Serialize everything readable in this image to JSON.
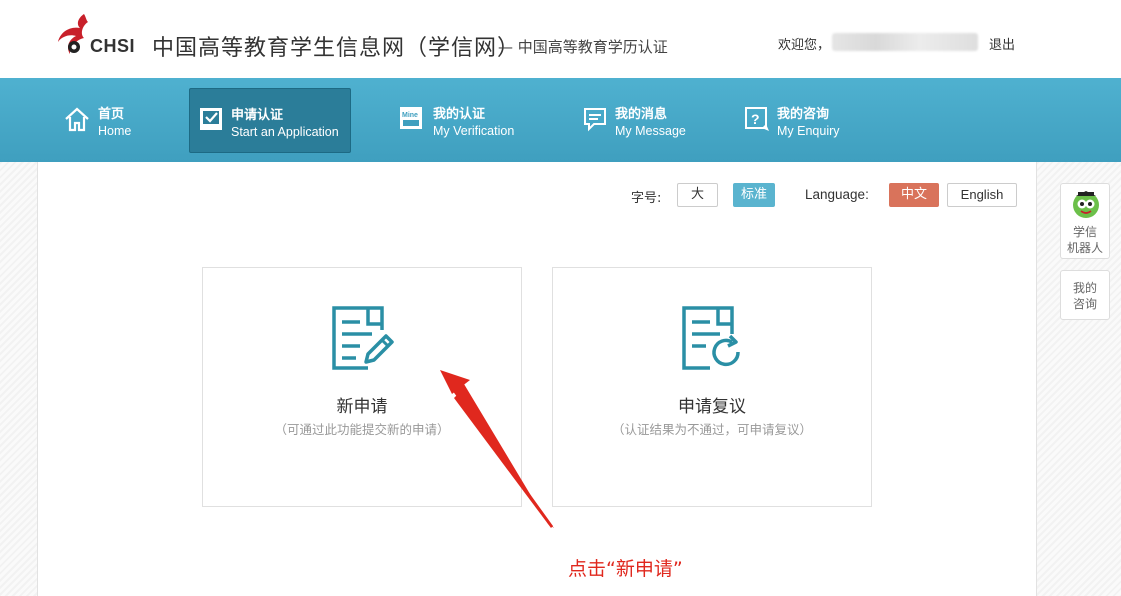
{
  "header": {
    "logo_text": "CHSI",
    "site_title": "中国高等教育学生信息网（学信网）",
    "site_subtitle": "— 中国高等教育学历认证",
    "welcome": "欢迎您，",
    "logout": "退出"
  },
  "nav": {
    "items": [
      {
        "zh": "首页",
        "en": "Home",
        "icon": "home-icon"
      },
      {
        "zh": "申请认证",
        "en": "Start an Application",
        "icon": "checkbox-icon",
        "active": true
      },
      {
        "zh": "我的认证",
        "en": "My Verification",
        "icon": "mine-icon"
      },
      {
        "zh": "我的消息",
        "en": "My Message",
        "icon": "message-icon"
      },
      {
        "zh": "我的咨询",
        "en": "My Enquiry",
        "icon": "question-icon"
      }
    ]
  },
  "toolbar": {
    "font_label": "字号:",
    "font_large": "大",
    "font_standard": "标准",
    "language_label": "Language:",
    "lang_zh": "中文",
    "lang_en": "English"
  },
  "cards": [
    {
      "title": "新申请",
      "desc": "（可通过此功能提交新的申请）",
      "icon": "edit-document-icon"
    },
    {
      "title": "申请复议",
      "desc": "（认证结果为不通过，可申请复议）",
      "icon": "refresh-document-icon"
    }
  ],
  "annotation": "点击“新申请”",
  "side": {
    "robot_label_1": "学信",
    "robot_label_2": "机器人",
    "enquiry_label_1": "我的",
    "enquiry_label_2": "咨询"
  },
  "colors": {
    "nav_bg": "#46a8c8",
    "nav_active": "#2b7d99",
    "accent_teal": "#2a8fa5",
    "lang_active": "#d9735b",
    "annotation": "#e0281e"
  }
}
